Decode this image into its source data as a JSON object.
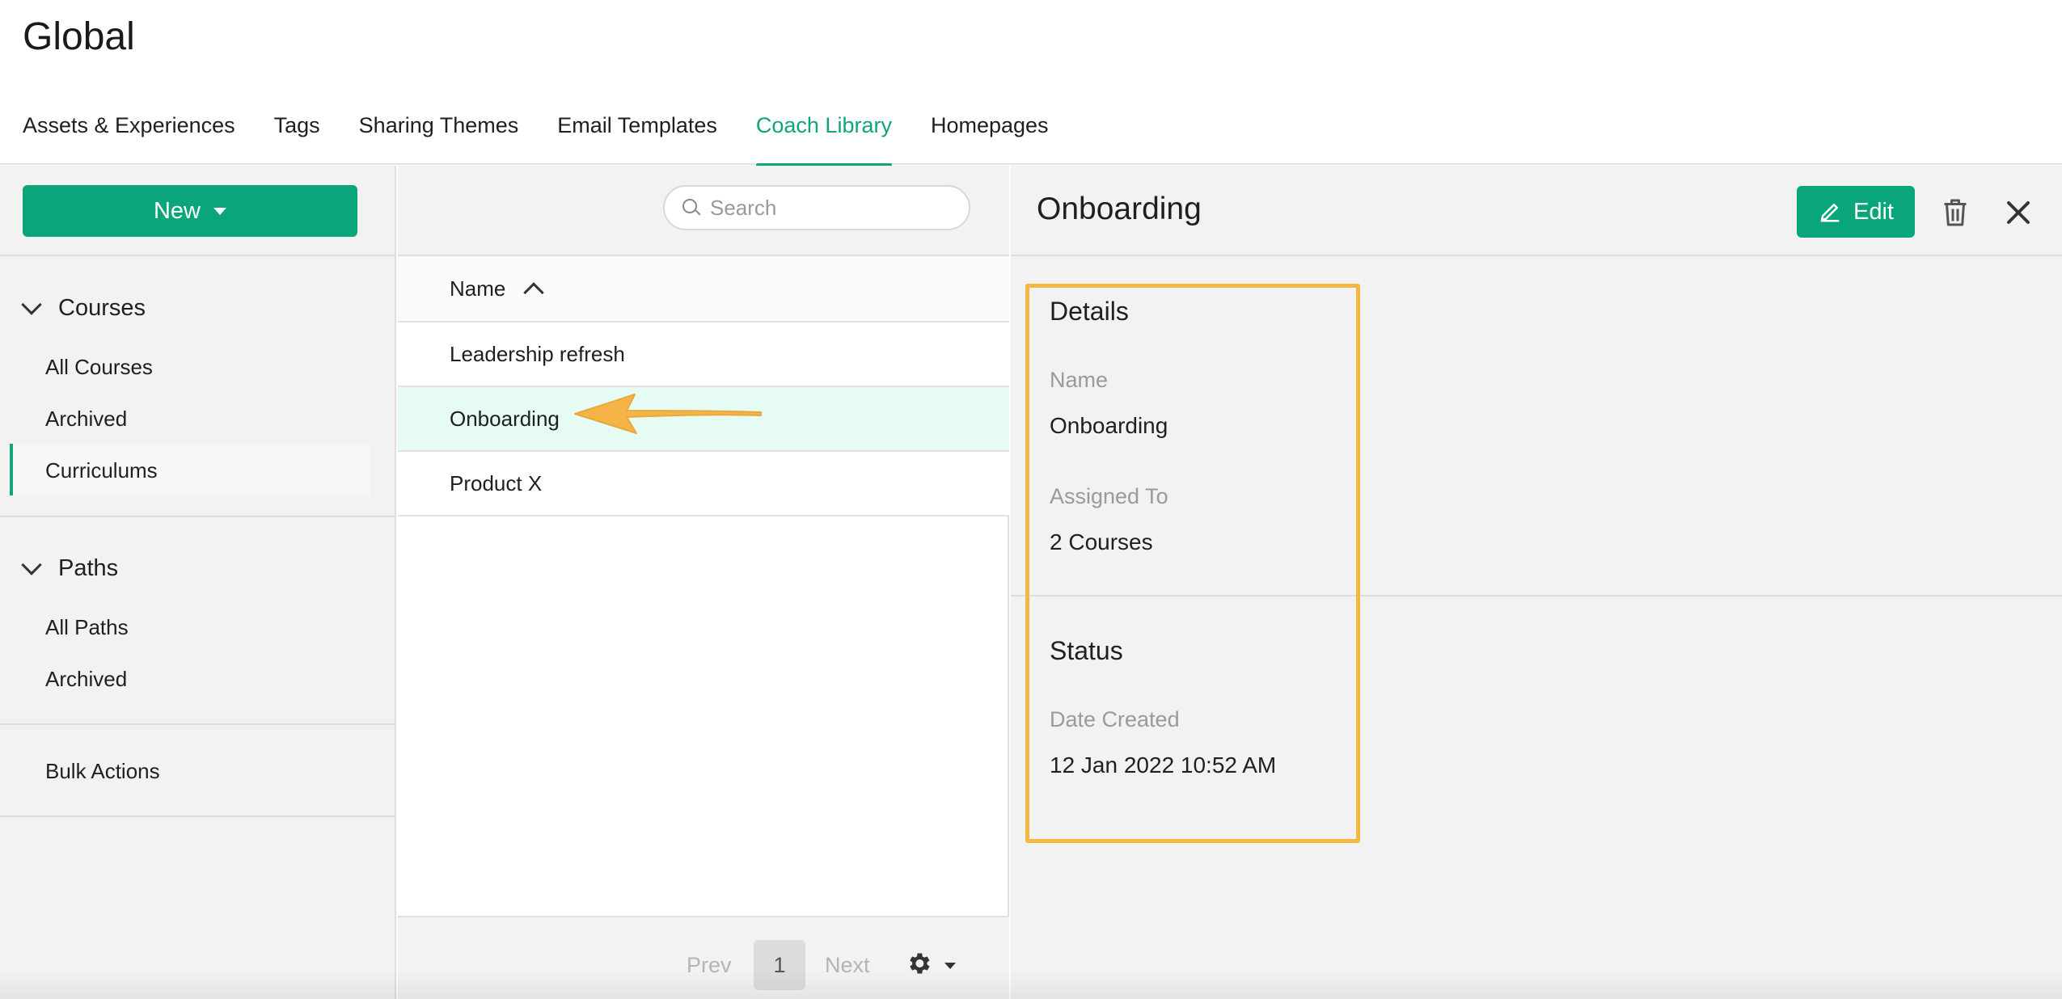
{
  "app": {
    "title": "Global"
  },
  "tabs": [
    {
      "label": "Assets & Experiences",
      "active": false
    },
    {
      "label": "Tags",
      "active": false
    },
    {
      "label": "Sharing Themes",
      "active": false
    },
    {
      "label": "Email Templates",
      "active": false
    },
    {
      "label": "Coach Library",
      "active": true
    },
    {
      "label": "Homepages",
      "active": false
    }
  ],
  "sidebar": {
    "new_label": "New",
    "courses": {
      "heading": "Courses",
      "items": [
        {
          "label": "All Courses"
        },
        {
          "label": "Archived"
        },
        {
          "label": "Curriculums",
          "active": true
        }
      ]
    },
    "paths": {
      "heading": "Paths",
      "items": [
        {
          "label": "All Paths"
        },
        {
          "label": "Archived"
        }
      ]
    },
    "bulk_actions": "Bulk Actions"
  },
  "list": {
    "search_placeholder": "Search",
    "column_header": "Name",
    "sort": "ascending",
    "rows": [
      {
        "name": "Leadership refresh",
        "selected": false
      },
      {
        "name": "Onboarding",
        "selected": true
      },
      {
        "name": "Product X",
        "selected": false
      }
    ],
    "pager": {
      "prev": "Prev",
      "page": "1",
      "next": "Next"
    }
  },
  "detail": {
    "title": "Onboarding",
    "edit_label": "Edit",
    "details_heading": "Details",
    "name_label": "Name",
    "name_value": "Onboarding",
    "assigned_label": "Assigned To",
    "assigned_value": "2 Courses",
    "status_heading": "Status",
    "date_label": "Date Created",
    "date_value": "12 Jan 2022 10:52 AM"
  },
  "colors": {
    "accent": "#0aa57a",
    "highlight": "#f5b642",
    "selected_row": "#e5fbf3"
  }
}
